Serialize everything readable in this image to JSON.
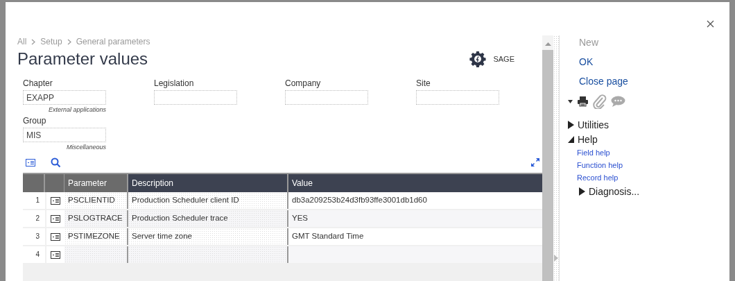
{
  "breadcrumb": [
    "All",
    "Setup",
    "General parameters"
  ],
  "title": "Parameter values",
  "user": "SAGE",
  "fields": [
    {
      "label": "Chapter",
      "value": "EXAPP",
      "caption": "External applications"
    },
    {
      "label": "Legislation"
    },
    {
      "label": "Company"
    },
    {
      "label": "Site"
    },
    {
      "label": "Group",
      "value": "MIS",
      "caption": "Miscellaneous"
    }
  ],
  "table": {
    "columns": [
      "Parameter",
      "Description",
      "Value"
    ],
    "rows": [
      {
        "number": "1",
        "cells": [
          "PSCLIENTID",
          "Production Scheduler client ID",
          "db3a209253b24d3fb93ffe3001db1d60"
        ]
      },
      {
        "number": "2",
        "cells": [
          "PSLOGTRACE",
          "Production Scheduler trace",
          "YES"
        ]
      },
      {
        "number": "3",
        "cells": [
          "PSTIMEZONE",
          "Server time zone",
          "GMT Standard Time"
        ]
      },
      {
        "number": "4"
      }
    ]
  },
  "actions": [
    {
      "label": "New",
      "disabled": true
    },
    {
      "label": "OK",
      "disabled": false
    },
    {
      "label": "Close page",
      "disabled": false
    }
  ],
  "menu": [
    {
      "label": "Utilities",
      "expanded": false
    },
    {
      "label": "Help",
      "expanded": true,
      "children": [
        {
          "kind": "link",
          "label": "Field help"
        },
        {
          "kind": "link",
          "label": "Function help"
        },
        {
          "kind": "link",
          "label": "Record help"
        },
        {
          "kind": "node",
          "label": "Diagnosis...",
          "expanded": false
        }
      ]
    }
  ]
}
